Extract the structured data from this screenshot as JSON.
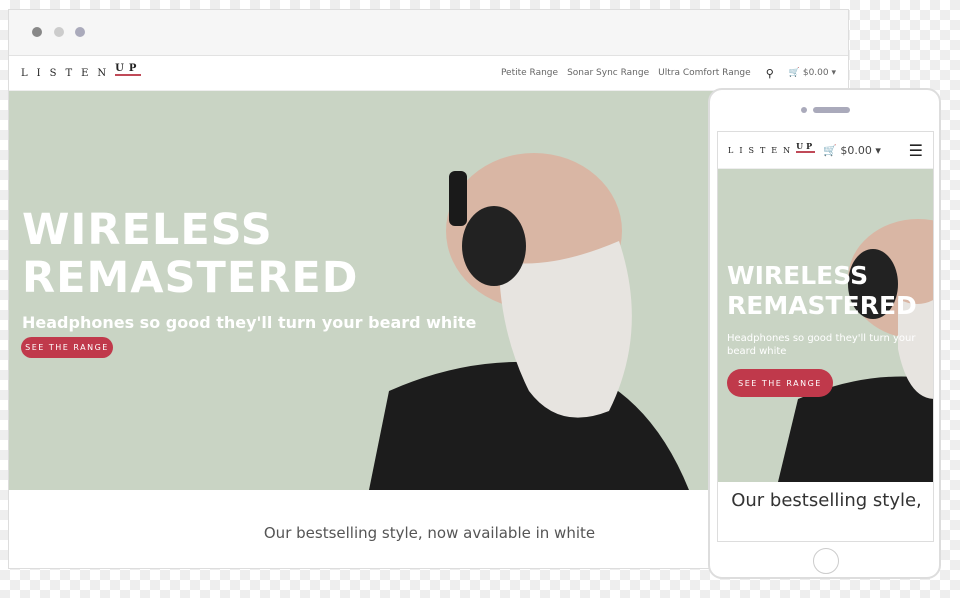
{
  "window": {
    "dots": [
      "#888",
      "#ccc",
      "#aab"
    ]
  },
  "brand": {
    "logo_main": "LISTEN",
    "logo_accent": "UP",
    "accent": "#c0394b"
  },
  "nav": {
    "links": [
      "Petite Range",
      "Sonar Sync Range",
      "Ultra Comfort Range"
    ],
    "cart_total": "$0.00",
    "search_icon": "search-icon",
    "cart_icon": "cart-icon"
  },
  "hero": {
    "title_line1": "WIRELESS",
    "title_line2": "REMASTERED",
    "subtitle": "Headphones so good they'll turn your beard white",
    "cta": "SEE THE RANGE",
    "bg": "#c9d4c4"
  },
  "section": {
    "heading": "Our bestselling style, now available in white"
  },
  "mobile": {
    "cart_total": "$0.00",
    "subtitle": "Headphones so good they'll turn your beard white",
    "section_heading": "Our bestselling style,"
  }
}
